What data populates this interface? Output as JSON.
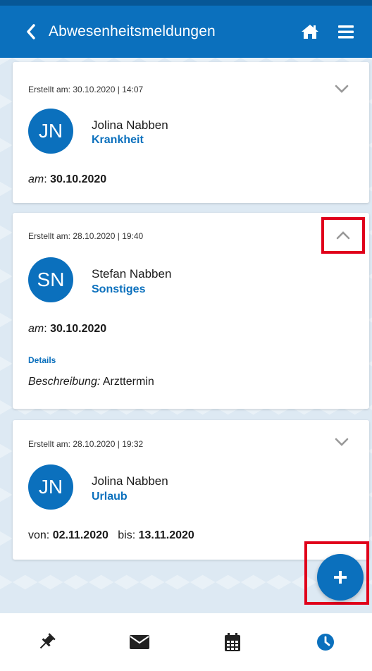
{
  "header": {
    "title": "Abwesenheitsmeldungen",
    "back_icon": "chevron-left-icon",
    "home_icon": "home-icon",
    "menu_icon": "hamburger-menu-icon"
  },
  "colors": {
    "primary": "#0b70bd",
    "header_top": "#075796",
    "highlight": "#e0001b",
    "background": "#dde9f3"
  },
  "cards": [
    {
      "created": "Erstellt am: 30.10.2020 | 14:07",
      "initials": "JN",
      "name": "Jolina Nabben",
      "type": "Krankheit",
      "date_label": "am",
      "date_value": "30.10.2020",
      "expanded": false
    },
    {
      "created": "Erstellt am: 28.10.2020 | 19:40",
      "initials": "SN",
      "name": "Stefan Nabben",
      "type": "Sonstiges",
      "date_label": "am",
      "date_value": "30.10.2020",
      "expanded": true,
      "details_heading": "Details",
      "description_label": "Beschreibung:",
      "description_value": "Arzttermin"
    },
    {
      "created": "Erstellt am: 28.10.2020 | 19:32",
      "initials": "JN",
      "name": "Jolina Nabben",
      "type": "Urlaub",
      "from_label": "von:",
      "from_value": "02.11.2020",
      "to_label": "bis:",
      "to_value": "13.11.2020",
      "expanded": false
    }
  ],
  "fab": {
    "label": "+",
    "icon": "plus-icon"
  },
  "bottom_nav": [
    {
      "icon": "pin-icon",
      "active": false
    },
    {
      "icon": "envelope-icon",
      "active": false
    },
    {
      "icon": "calendar-icon",
      "active": false
    },
    {
      "icon": "clock-icon",
      "active": true
    }
  ]
}
